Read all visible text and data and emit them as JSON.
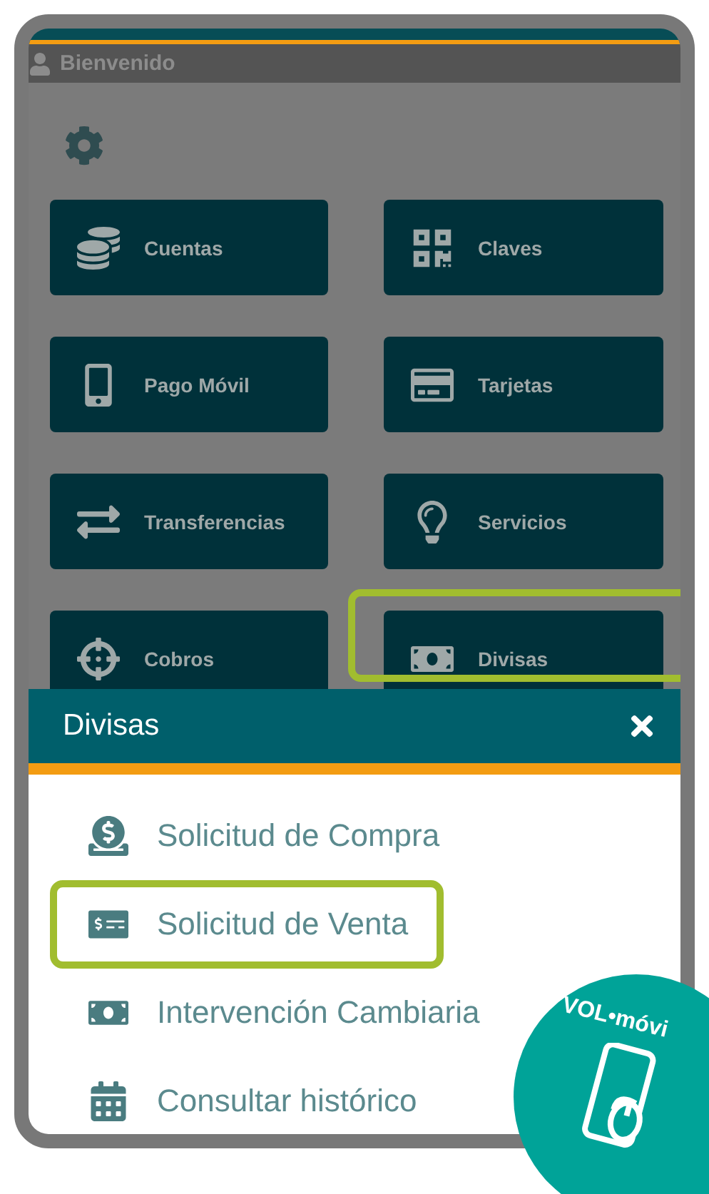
{
  "header": {
    "title": "Bienvenido"
  },
  "tiles": [
    {
      "label": "Cuentas",
      "highlighted": false
    },
    {
      "label": "Claves",
      "highlighted": false
    },
    {
      "label": "Pago Móvil",
      "highlighted": false
    },
    {
      "label": "Tarjetas",
      "highlighted": false
    },
    {
      "label": "Transferencias",
      "highlighted": false
    },
    {
      "label": "Servicios",
      "highlighted": false
    },
    {
      "label": "Cobros",
      "highlighted": false
    },
    {
      "label": "Divisas",
      "highlighted": true
    }
  ],
  "sheet": {
    "title": "Divisas",
    "items": [
      {
        "label": "Solicitud de Compra",
        "highlighted": false
      },
      {
        "label": "Solicitud de Venta",
        "highlighted": true
      },
      {
        "label": "Intervención Cambiaria",
        "highlighted": false
      },
      {
        "label": "Consultar histórico",
        "highlighted": false
      }
    ]
  },
  "badge": {
    "text": "VOL•móvi"
  }
}
